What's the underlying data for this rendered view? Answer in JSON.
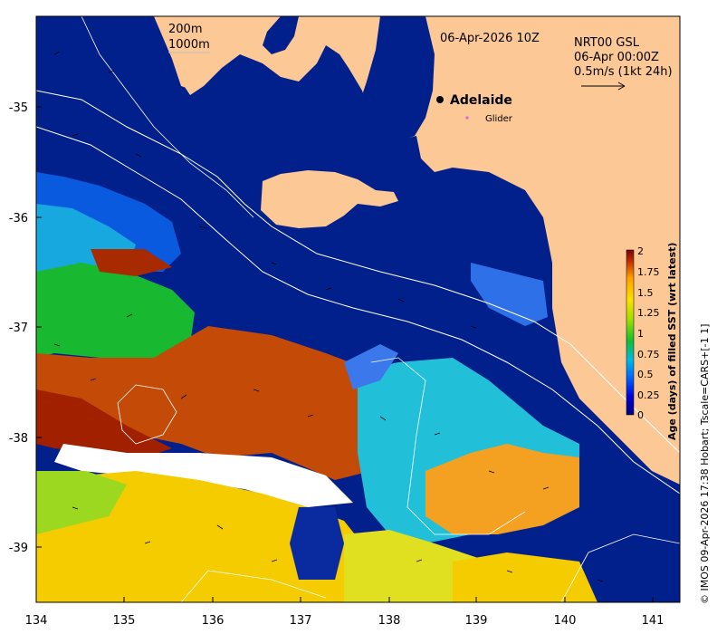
{
  "map": {
    "timestamp": "06-Apr-2026 10Z",
    "product": "NRT00 GSL",
    "product_time": "06-Apr 00:00Z",
    "vector_scale": "0.5m/s (1kt 24h)",
    "isobaths": [
      "200m",
      "1000m"
    ],
    "city": "Adelaide",
    "glider_label": "Glider",
    "credit": "© IMOS 09-Apr-2026 17:38 Hobart; Tscale=CARS+[-1 1]",
    "colors": {
      "land": "#fcc896",
      "shelf": "#02208c",
      "glider": "#e060e0"
    }
  },
  "axes": {
    "x_ticks": [
      "134",
      "135",
      "136",
      "137",
      "138",
      "139",
      "140",
      "141"
    ],
    "y_ticks": [
      "-35",
      "-36",
      "-37",
      "-38",
      "-39"
    ]
  },
  "colorbar": {
    "title": "Age (days) of filled SST (wrt latest)",
    "ticks": [
      "0",
      "0.25",
      "0.5",
      "0.75",
      "1",
      "1.25",
      "1.5",
      "1.75",
      "2"
    ],
    "colors": [
      "#000080",
      "#0000d8",
      "#0060ff",
      "#00b8e8",
      "#10c030",
      "#a0e000",
      "#ffe000",
      "#ffa000",
      "#c03000",
      "#800000"
    ]
  }
}
